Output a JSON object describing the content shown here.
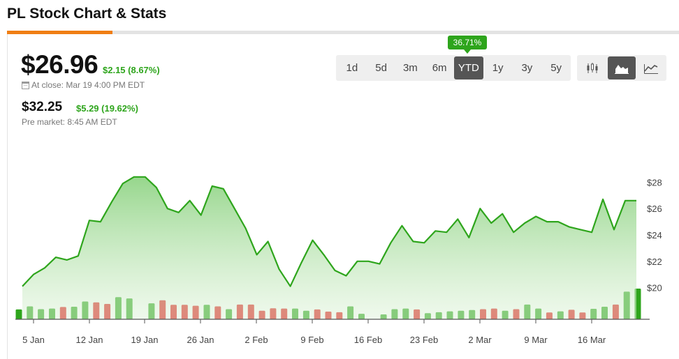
{
  "page": {
    "title": "PL Stock Chart & Stats"
  },
  "quote": {
    "price": "$26.96",
    "change": "$2.15 (8.67%)",
    "close_label": "At close: Mar 19 4:00 PM EDT",
    "premarket_price": "$32.25",
    "premarket_change": "$5.29 (19.62%)",
    "premarket_label": "Pre market: 8:45 AM EDT"
  },
  "ranges": {
    "items": [
      "1d",
      "5d",
      "3m",
      "6m",
      "YTD",
      "1y",
      "3y",
      "5y"
    ],
    "active": "YTD",
    "active_return": "36.71%"
  },
  "chart_types": {
    "items": [
      "candlestick-icon",
      "area-chart-icon",
      "line-chart-icon"
    ],
    "active": "area-chart-icon"
  },
  "colors": {
    "up": "#2ea51c",
    "down": "#e01b1b",
    "accent": "#f07e14",
    "line": "#2ea51c"
  },
  "chart_data": {
    "type": "area",
    "x_ticks": [
      "5 Jan",
      "12 Jan",
      "19 Jan",
      "26 Jan",
      "2 Feb",
      "9 Feb",
      "16 Feb",
      "23 Feb",
      "2 Mar",
      "9 Mar",
      "16 Mar"
    ],
    "y_ticks": [
      "$28",
      "$26",
      "$24",
      "$22",
      "$20"
    ],
    "ylim": [
      17.6,
      29.5
    ],
    "grid": false,
    "price_series": {
      "name": "",
      "values": [
        20.1,
        21.0,
        21.5,
        22.3,
        22.1,
        22.4,
        25.1,
        25.0,
        26.5,
        27.9,
        28.4,
        28.4,
        27.6,
        26.0,
        25.7,
        26.6,
        25.5,
        27.7,
        27.5,
        26.0,
        24.5,
        22.5,
        23.5,
        21.4,
        20.1,
        21.9,
        23.6,
        22.5,
        21.3,
        20.9,
        22.0,
        22.0,
        21.8,
        23.4,
        24.7,
        23.5,
        23.4,
        24.3,
        24.2,
        25.2,
        23.8,
        26.0,
        24.9,
        25.6,
        24.2,
        24.9,
        25.4,
        25.0,
        25.0,
        24.6,
        24.4,
        24.2,
        26.7,
        24.4,
        26.6,
        26.6
      ]
    },
    "volume_series": {
      "name": "",
      "values": [
        0.32,
        0.42,
        0.33,
        0.35,
        0.4,
        0.41,
        0.58,
        0.55,
        0.5,
        0.72,
        0.68,
        0.0,
        0.52,
        0.62,
        0.47,
        0.47,
        0.44,
        0.47,
        0.42,
        0.33,
        0.48,
        0.48,
        0.28,
        0.36,
        0.35,
        0.35,
        0.28,
        0.32,
        0.25,
        0.23,
        0.42,
        0.18,
        0.0,
        0.16,
        0.33,
        0.35,
        0.32,
        0.2,
        0.23,
        0.26,
        0.28,
        0.3,
        0.33,
        0.35,
        0.28,
        0.33,
        0.48,
        0.35,
        0.22,
        0.26,
        0.31,
        0.22,
        0.34,
        0.41,
        0.48,
        0.9,
        1.0
      ],
      "up": [
        true,
        true,
        true,
        true,
        false,
        true,
        true,
        false,
        false,
        true,
        true,
        true,
        true,
        false,
        false,
        false,
        false,
        true,
        false,
        true,
        false,
        false,
        false,
        false,
        false,
        true,
        true,
        false,
        false,
        false,
        true,
        true,
        true,
        true,
        true,
        true,
        false,
        true,
        true,
        true,
        true,
        true,
        false,
        false,
        true,
        false,
        true,
        true,
        false,
        true,
        false,
        false,
        true,
        true,
        false,
        true,
        true
      ]
    }
  }
}
